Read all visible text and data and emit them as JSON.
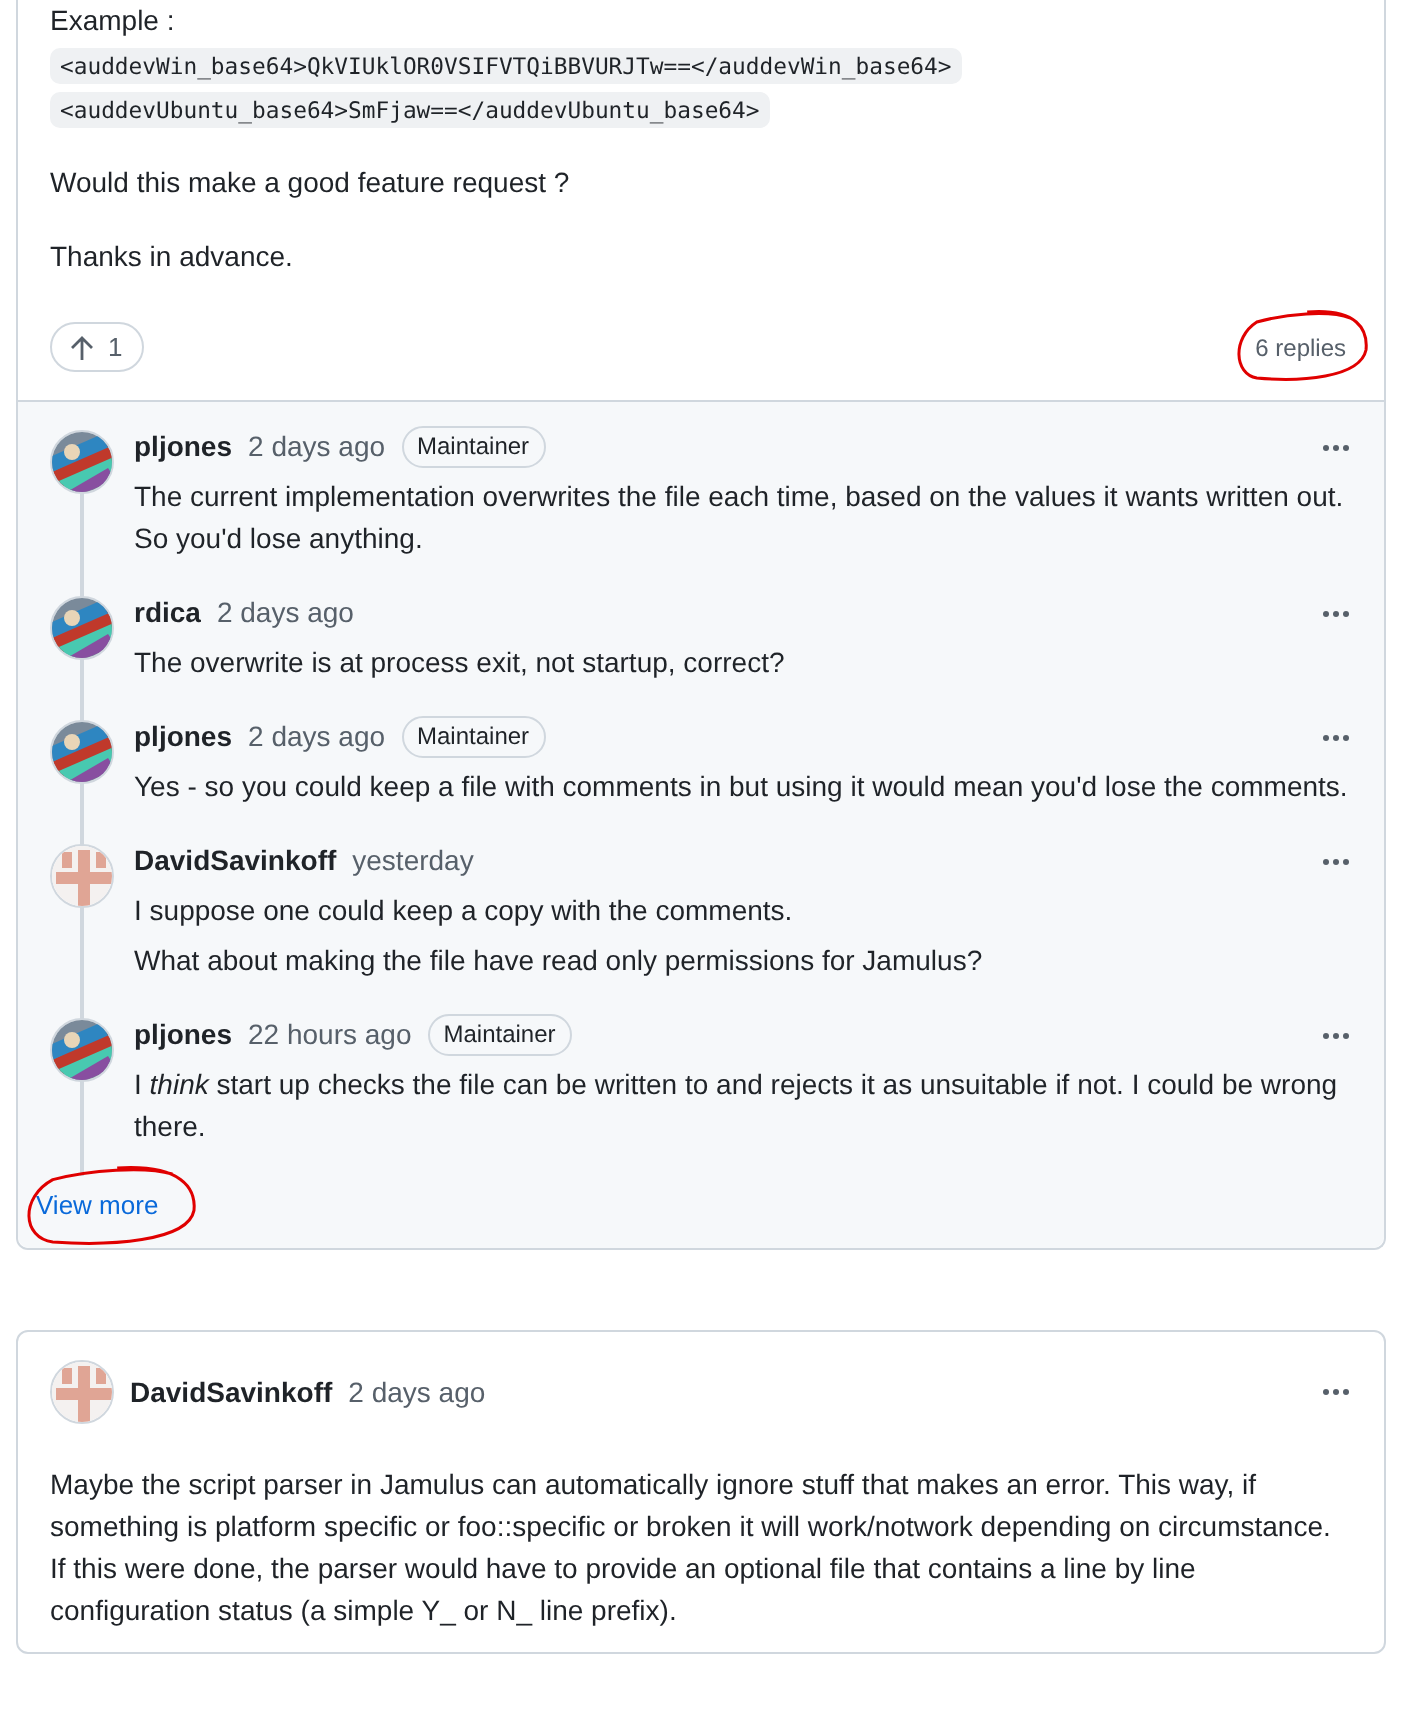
{
  "post": {
    "example_label": "Example :",
    "code_lines": [
      "<auddevWin_base64>QkVIUklOR0VSIFVTQiBBVURJTw==</auddevWin_base64>",
      "<auddevUbuntu_base64>SmFjaw==</auddevUbuntu_base64>"
    ],
    "paragraphs": [
      "Would this make a good feature request ?",
      "Thanks in advance."
    ],
    "upvotes": "1",
    "reply_count": {
      "text": "6 replies",
      "circled": true
    }
  },
  "replies": [
    {
      "author": "pljones",
      "time": "2 days ago",
      "badge": "Maintainer",
      "avatar": {
        "kind": "picture"
      },
      "body": [
        "The current implementation overwrites the file each time, based on the values it wants written out. So you'd lose anything."
      ]
    },
    {
      "author": "rdica",
      "time": "2 days ago",
      "avatar": {
        "kind": "picture"
      },
      "body": [
        "The overwrite is at process exit, not startup, correct?"
      ]
    },
    {
      "author": "pljones",
      "time": "2 days ago",
      "badge": "Maintainer",
      "avatar": {
        "kind": "picture"
      },
      "body": [
        "Yes - so you could keep a file with comments in but using it would mean you'd lose the comments."
      ]
    },
    {
      "author": "DavidSavinkoff",
      "time": "yesterday",
      "avatar": {
        "kind": "identicon"
      },
      "body": [
        "I suppose one could keep a copy with the comments.",
        "What about making the file have read only permissions for Jamulus?"
      ]
    },
    {
      "author": "pljones",
      "time": "22 hours ago",
      "badge": "Maintainer",
      "avatar": {
        "kind": "picture"
      },
      "body": [
        "I *think* start up checks the file can be written to and rejects it as unsuitable if not. I could be wrong there."
      ]
    }
  ],
  "view_more": {
    "text": "View more",
    "circled": true
  },
  "next_comment": {
    "author": "DavidSavinkoff",
    "time": "2 days ago",
    "avatar": {
      "kind": "identicon"
    },
    "body": [
      "Maybe the script parser in Jamulus can automatically ignore stuff that makes an error. This way, if something is platform specific or foo::specific or broken it will work/notwork depending on circumstance. If this were done, the parser would have to provide an optional file that contains a line by line configuration status (a simple Y_ or N_ line prefix)."
    ]
  }
}
